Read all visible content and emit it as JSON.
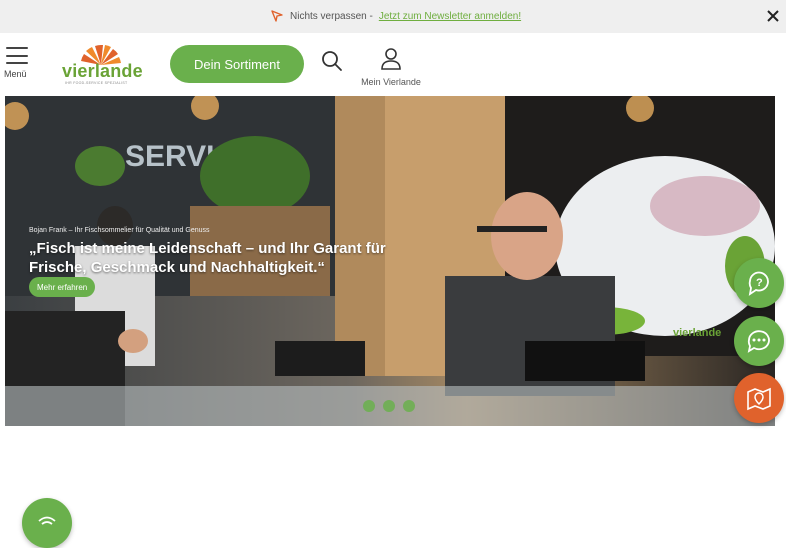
{
  "topbar": {
    "text": "Nichts verpassen -",
    "link": "Jetzt zum Newsletter anmelden!",
    "icon": "cursor-icon",
    "close_icon": "close-icon"
  },
  "header": {
    "menu_label": "Menü",
    "logo_text": "vierlande",
    "logo_tagline": "IHR FOOD-SERVICE SPEZIALIST",
    "sortiment_label": "Dein Sortiment",
    "account_label": "Mein Vierlande"
  },
  "hero": {
    "small_caption": "Bojan Frank – Ihr Fischsommelier für Qualität und Genuss",
    "quote": "„Fisch ist meine Leidenschaft – und Ihr Garant für Frische, Geschmack und Nachhaltigkeit.“",
    "cta_label": "Mehr erfahren",
    "slides": 3
  },
  "colors": {
    "brand_green": "#6ab04c",
    "map_orange": "#e0622c",
    "link_green": "#6fae3f"
  },
  "fabs": [
    "help-icon",
    "chat-icon",
    "map-icon",
    "wifi-icon"
  ]
}
